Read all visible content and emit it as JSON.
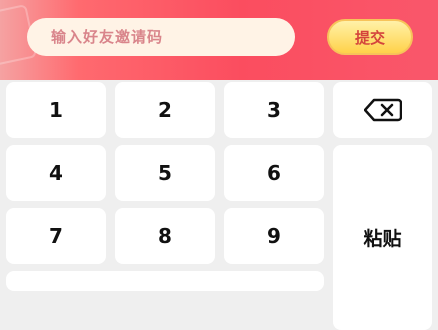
{
  "header": {
    "input_placeholder": "输入好友邀请码",
    "submit_label": "提交"
  },
  "keypad": {
    "keys": [
      "1",
      "2",
      "3",
      "4",
      "5",
      "6",
      "7",
      "8",
      "9"
    ],
    "backspace_icon": "backspace-icon",
    "paste_label": "粘贴"
  },
  "colors": {
    "header_gradient_start": "#f5a2a2",
    "header_gradient_end": "#f9576b",
    "input_bg": "#fff3e6",
    "placeholder_text": "#d9858b",
    "submit_bg": "#ffd24a",
    "submit_text": "#d4443c",
    "keypad_bg": "#efefef",
    "key_bg": "#ffffff"
  }
}
